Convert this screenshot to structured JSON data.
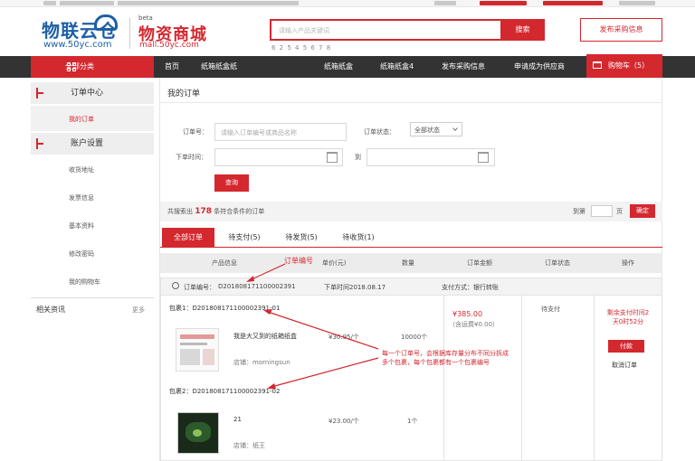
{
  "brand": {
    "logo_left": "物联云仓",
    "logo_left_url": "www.50yc.com",
    "beta": "beta",
    "logo_right": "物资商城",
    "logo_right_url": "mall.50yc.com"
  },
  "search": {
    "placeholder": "请输入产品关键词",
    "button": "搜索",
    "hot_words": "6 2 5 4 5 6 7 8",
    "publish_button": "发布采购信息"
  },
  "nav": {
    "all_categories": "全部分类",
    "items": [
      "首页",
      "纸箱纸盒纸",
      "纸箱纸盒",
      "纸箱纸盒4",
      "发布采购信息",
      "申请成为供应商"
    ],
    "cart": "购物车（5）"
  },
  "sidebar": {
    "sections": [
      {
        "title": "订单中心",
        "items": [
          "我的订单"
        ]
      },
      {
        "title": "账户设置",
        "items": [
          "收货地址",
          "发票信息",
          "基本资料",
          "修改密码",
          "我的购物车"
        ]
      }
    ],
    "related_title": "相关资讯",
    "related_more": "更多"
  },
  "main": {
    "title": "我的订单",
    "filters": {
      "order_no_label": "订单号：",
      "order_no_placeholder": "请输入订单编号或商品名称",
      "status_label": "订单状态：",
      "status_value": "全部状态",
      "date_label": "下单时间：",
      "to_label": "到",
      "query_button": "查询"
    },
    "summary": {
      "prefix": "共搜索出",
      "count": "178",
      "suffix": "条符合条件的订单",
      "goto_label": "到第",
      "page_label": "页",
      "goto_button": "确定"
    },
    "tabs": [
      "全部订单",
      "待支付(5)",
      "待发货(5)",
      "待收货(1)"
    ],
    "table_headers": [
      "产品信息",
      "单价(元)",
      "数量",
      "订单金额",
      "订单状态",
      "操作"
    ],
    "order": {
      "order_no_label": "订单编号：",
      "order_no": "D201808171100002391",
      "order_time": "下单时间2018.08.17",
      "pay_method": "支付方式：银行转账",
      "packages": [
        {
          "label": "包裹1：D201808171100002391-01",
          "product_name": "我是大又到的纸箱纸盒",
          "shop": "店铺：morningsun",
          "price": "¥30.95/个",
          "qty": "10000个"
        },
        {
          "label": "包裹2：D201808171100002391-02",
          "product_name": "21",
          "shop": "店铺：纸王",
          "price": "¥23.00/个",
          "qty": "1个"
        }
      ],
      "amount": "¥385.00",
      "freight": "（含运费¥0.00）",
      "status": "待支付",
      "countdown": "剩余支付时间2天0时52分",
      "pay_button": "付款",
      "cancel": "取消订单"
    }
  },
  "annotations": {
    "order_no_note": "订单编号",
    "package_note_line1": "每一个订单号，会根据库存量分布不同分拆成",
    "package_note_line2": "多个包裹，每个包裹都有一个包裹编号"
  }
}
